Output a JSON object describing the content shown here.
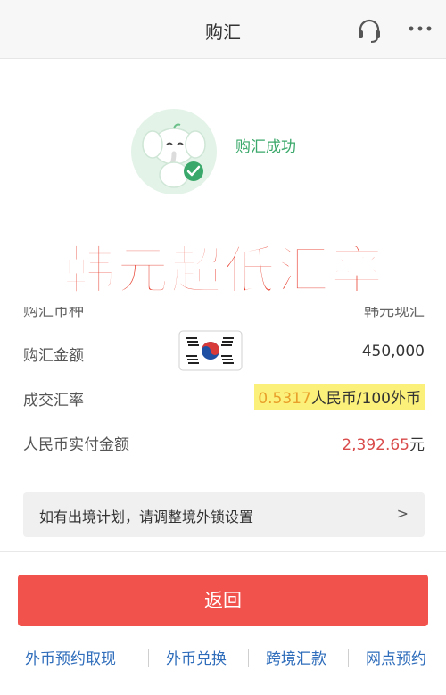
{
  "header": {
    "title": "购汇",
    "support_icon": "headset-icon",
    "more_icon": "more-dots-icon"
  },
  "result": {
    "status_text": "购汇成功",
    "mascot": "elephant-mascot-with-checkmark"
  },
  "banner": {
    "text": "韩元超低汇率"
  },
  "details": {
    "currency_label": "购汇币种",
    "currency_value": "韩元现汇",
    "amount_label": "购汇金额",
    "amount_value": "450,000",
    "rate_label": "成交汇率",
    "rate_number": "0.5317",
    "rate_unit": "人民币/100外币",
    "total_label": "人民币实付金额",
    "total_amount": "2,392.65",
    "total_unit": "元"
  },
  "notice": {
    "text": "如有出境计划，请调整境外锁设置",
    "chevron": ">"
  },
  "actions": {
    "return_label": "返回"
  },
  "bottom_links": [
    "外币预约取现",
    "外币兑换",
    "跨境汇款",
    "网点预约"
  ],
  "colors": {
    "accent_green": "#3aa86a",
    "button_red": "#f2524c",
    "link_blue": "#2f6dbb",
    "highlight_yellow": "#fbf07a"
  }
}
